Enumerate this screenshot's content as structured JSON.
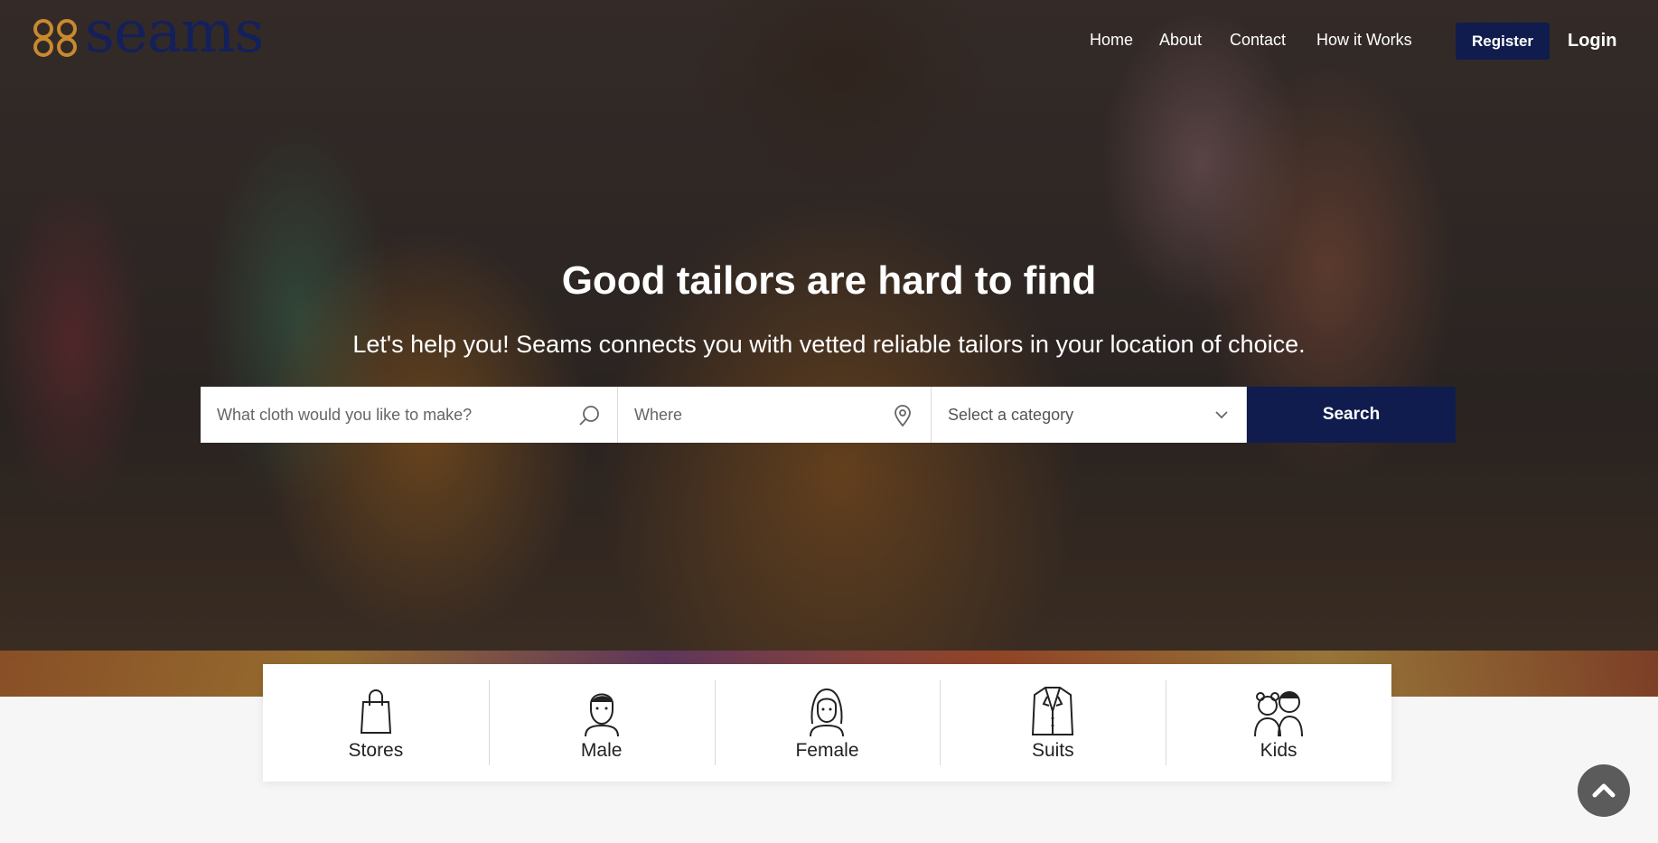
{
  "brand": {
    "name": "seams",
    "mark_color": "#c8892f",
    "text_color": "#14205a"
  },
  "nav": {
    "items": [
      "Home",
      "About",
      "Contact",
      "How it Works"
    ],
    "register": "Register",
    "login": "Login"
  },
  "hero": {
    "headline": "Good tailors are hard to find",
    "subline": "Let's help you! Seams connects you with vetted reliable tailors in your location of choice."
  },
  "search": {
    "cloth_placeholder": "What cloth would you like to make?",
    "where_placeholder": "Where",
    "category_selected": "Select a category",
    "button": "Search"
  },
  "categories": [
    {
      "label": "Stores",
      "icon": "shopping-bag-icon"
    },
    {
      "label": "Male",
      "icon": "male-avatar-icon"
    },
    {
      "label": "Female",
      "icon": "female-avatar-icon"
    },
    {
      "label": "Suits",
      "icon": "suit-jacket-icon"
    },
    {
      "label": "Kids",
      "icon": "kids-icon"
    }
  ],
  "colors": {
    "primary": "#0f1c4d",
    "accent": "#c8892f"
  }
}
